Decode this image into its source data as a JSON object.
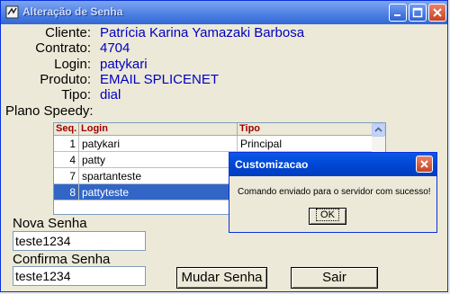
{
  "window": {
    "title": "Alteração de Senha",
    "icons": [
      "app-icon",
      "minimize-icon",
      "maximize-icon",
      "close-icon"
    ]
  },
  "info": {
    "cliente_label": "Cliente:",
    "cliente_value": "Patrícia Karina Yamazaki Barbosa",
    "contrato_label": "Contrato:",
    "contrato_value": "4704",
    "login_label": "Login:",
    "login_value": "patykari",
    "produto_label": "Produto:",
    "produto_value": "EMAIL SPLICENET",
    "tipo_label": "Tipo:",
    "tipo_value": "dial",
    "plano_label": "Plano Speedy:"
  },
  "grid": {
    "columns": [
      "Seq.",
      "Login",
      "Tipo"
    ],
    "rows": [
      {
        "seq": "1",
        "login": "patykari",
        "tipo": "Principal"
      },
      {
        "seq": "4",
        "login": "patty",
        "tipo": ""
      },
      {
        "seq": "7",
        "login": "spartanteste",
        "tipo": ""
      },
      {
        "seq": "8",
        "login": "pattyteste",
        "tipo": ""
      }
    ],
    "selected_row": 3
  },
  "form": {
    "nova_senha_label": "Nova Senha",
    "nova_senha_value": "teste1234",
    "confirma_senha_label": "Confirma Senha",
    "confirma_senha_value": "teste1234",
    "mudar_button": "Mudar Senha",
    "sair_button": "Sair"
  },
  "dialog": {
    "title": "Customizacao",
    "message": "Comando enviado para o servidor com sucesso!",
    "ok_button": "OK"
  },
  "colors": {
    "value_text": "#0000c0",
    "selection": "#3166c6",
    "header_text": "#a00000",
    "window_bg": "#ece9d8"
  }
}
